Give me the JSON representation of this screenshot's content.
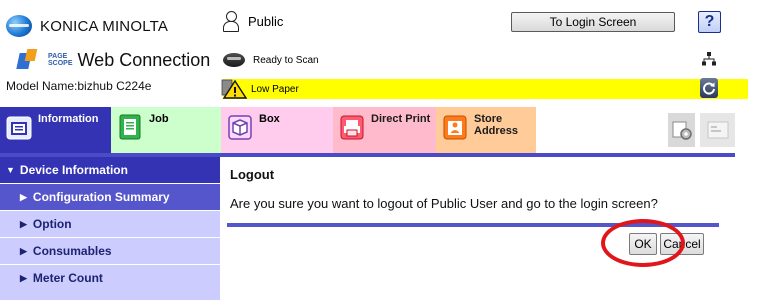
{
  "header": {
    "brand": "KONICA MINOLTA",
    "pagescope_small": [
      "PAGE",
      "SCOPE"
    ],
    "product_title": "Web Connection",
    "model_label": "Model Name:",
    "model_value": "bizhub C224e",
    "user_label": "Public",
    "status_scan": "Ready to Scan",
    "status_warning": "Low Paper",
    "login_button": "To Login Screen",
    "help_button": "?"
  },
  "tabs": [
    {
      "label": "Information",
      "icon": "information-icon"
    },
    {
      "label": "Job",
      "icon": "job-icon"
    },
    {
      "label": "Box",
      "icon": "box-icon"
    },
    {
      "label": "Direct Print",
      "icon": "direct-print-icon"
    },
    {
      "label": "Store Address",
      "icon": "store-address-icon"
    }
  ],
  "sidebar": {
    "header": "Device Information",
    "items": [
      {
        "label": "Configuration Summary",
        "active": true
      },
      {
        "label": "Option",
        "active": false
      },
      {
        "label": "Consumables",
        "active": false
      },
      {
        "label": "Meter Count",
        "active": false
      }
    ]
  },
  "main": {
    "title": "Logout",
    "message": "Are you sure you want to logout of Public User and go to the login screen?",
    "ok_button": "OK",
    "cancel_button": "Cancel"
  },
  "colors": {
    "tab_information": "#3333b3",
    "tab_job": "#ccffcc",
    "tab_box": "#ffccee",
    "tab_direct_print": "#ffbbcc",
    "tab_store_address": "#ffcc99",
    "warning_bar": "#ffff00",
    "sidebar_bg": "#ccccff",
    "highlight_circle": "#e0161b"
  }
}
